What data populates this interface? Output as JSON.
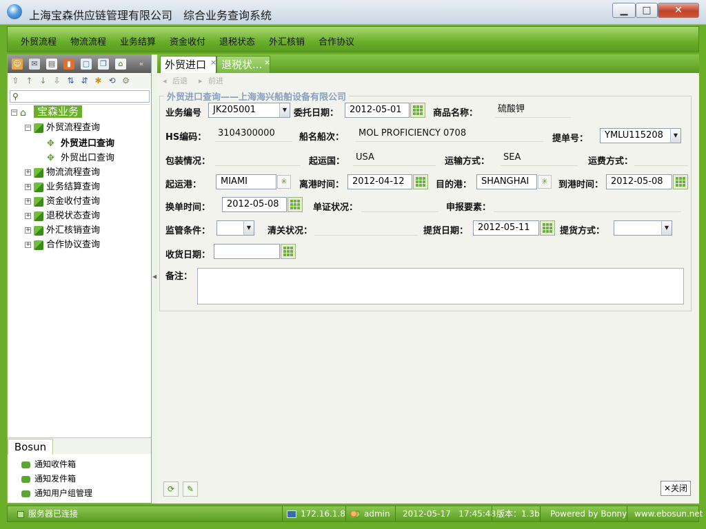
{
  "window": {
    "title": "上海宝森供应链管理有限公司",
    "subtitle": "综合业务查询系统",
    "minimize_label": "▁",
    "maximize_label": "□",
    "close_label": "✕"
  },
  "menu": {
    "items": [
      "外贸流程",
      "物流流程",
      "业务结算",
      "资金收付",
      "退税状态",
      "外汇核销",
      "合作协议"
    ]
  },
  "left": {
    "toolbar_icons": [
      "users-icon",
      "mail-icon",
      "document-icon",
      "chart-icon",
      "window-icon",
      "copy-icon",
      "home-icon",
      "collapse-icon"
    ],
    "tree": {
      "root": "宝森业务",
      "nodes": [
        {
          "label": "外贸流程查询",
          "expanded": true,
          "children": [
            "外贸进口查询",
            "外贸出口查询"
          ]
        },
        {
          "label": "物流流程查询"
        },
        {
          "label": "业务结算查询"
        },
        {
          "label": "资金收付查询"
        },
        {
          "label": "退税状态查询"
        },
        {
          "label": "外汇核销查询"
        },
        {
          "label": "合作协议查询"
        }
      ]
    },
    "footer_tab": "Bosun",
    "notices": [
      "通知收件箱",
      "通知发件箱",
      "通知用户组管理"
    ]
  },
  "tabs": [
    {
      "label": "外贸进口",
      "active": true
    },
    {
      "label": "退税状...",
      "active": false
    }
  ],
  "subtoolbar": {
    "prev": "后退",
    "next": "前进"
  },
  "form": {
    "legend": "外贸进口查询——上海海兴船舶设备有限公司",
    "labels": {
      "biz_no": "业务编号",
      "entrust_date": "委托日期：",
      "goods_name": "商品名称：",
      "hs_code": "HS编码：",
      "vessel": "船名船次：",
      "bl_no": "提单号：",
      "packing": "包装情况：",
      "origin_country": "起运国：",
      "transport": "运输方式：",
      "freight": "运费方式：",
      "origin_port": "起运港：",
      "depart_time": "离港时间：",
      "dest_port": "目的港：",
      "arrive_time": "到港时间：",
      "exchange_time": "换单时间：",
      "docs_status": "单证状况：",
      "declare_items": "申报要素：",
      "supervision": "监管条件：",
      "clearance": "清关状况：",
      "pickup_date": "提货日期：",
      "pickup_method": "提货方式：",
      "receive_date": "收货日期：",
      "remarks": "备注："
    },
    "values": {
      "biz_no": "JK205001",
      "entrust_date": "2012-05-01",
      "goods_name": "硫酸钾",
      "hs_code": "3104300000",
      "vessel": "MOL PROFICIENCY 0708",
      "bl_no": "YMLU115208",
      "origin_country": "USA",
      "transport": "SEA",
      "origin_port": "MIAMI",
      "depart_time": "2012-04-12",
      "dest_port": "SHANGHAI",
      "arrive_time": "2012-05-08",
      "exchange_time": "2012-05-08",
      "pickup_date": "2012-05-11"
    }
  },
  "actions": {
    "close_label": "关闭"
  },
  "status": {
    "connection": "服务器已连接",
    "ip": "172.16.1.8",
    "user": "admin",
    "date": "2012-05-17",
    "time": "17:45:48",
    "version_label": "版本：",
    "version": "1.3b",
    "powered_by": "Powered by Bonny",
    "website": "www.ebosun.net"
  },
  "colors": {
    "accent": "#6aae2a",
    "legend": "#8aa0c0"
  }
}
